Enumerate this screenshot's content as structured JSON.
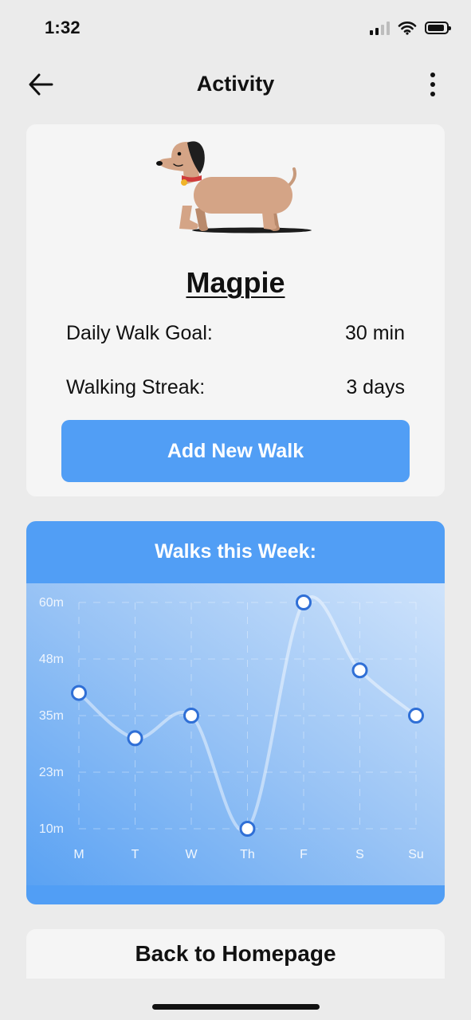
{
  "status_bar": {
    "time": "1:32"
  },
  "nav": {
    "title": "Activity"
  },
  "profile": {
    "name": "Magpie",
    "stats": [
      {
        "label": "Daily Walk Goal:",
        "value": "30 min"
      },
      {
        "label": "Walking Streak:",
        "value": "3 days"
      }
    ],
    "add_walk_label": "Add New Walk"
  },
  "chart_section": {
    "title": "Walks this Week:"
  },
  "chart_data": {
    "type": "line",
    "title": "Walks this Week:",
    "categories": [
      "M",
      "T",
      "W",
      "Th",
      "F",
      "S",
      "Su"
    ],
    "values": [
      40,
      30,
      35,
      10,
      60,
      45,
      35
    ],
    "y_ticks": [
      "10m",
      "23m",
      "35m",
      "48m",
      "60m"
    ],
    "ylim": [
      10,
      60
    ],
    "grid": true,
    "smooth": true
  },
  "footer": {
    "home_label": "Back to Homepage"
  },
  "colors": {
    "accent": "#519ef5",
    "card": "#f5f5f5",
    "background": "#ebebeb"
  }
}
